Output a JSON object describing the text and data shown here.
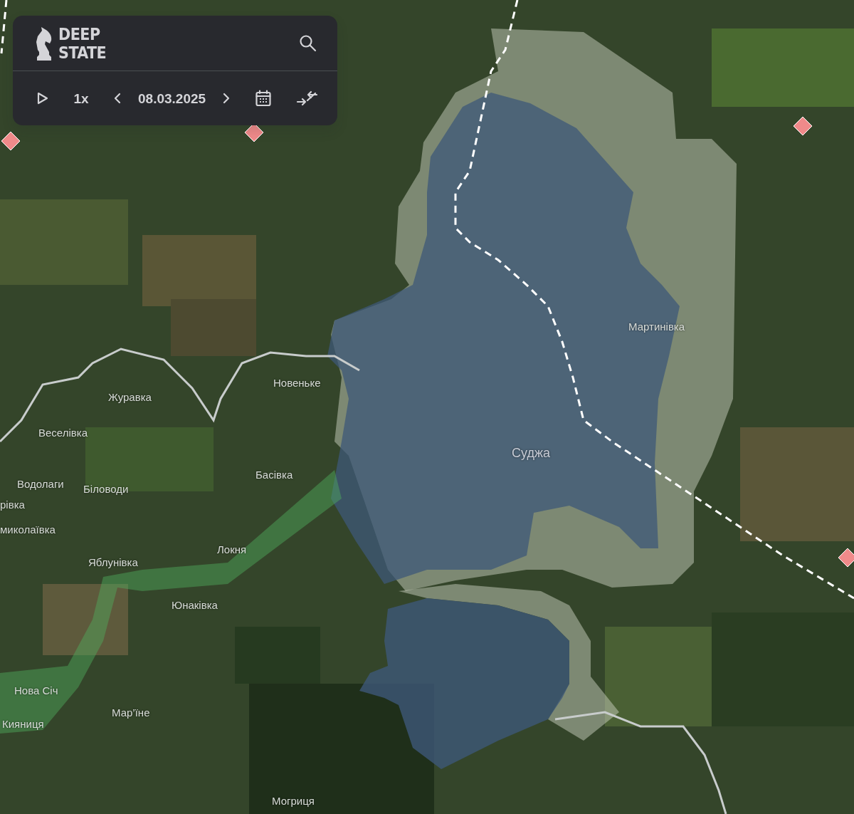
{
  "logo": {
    "lines": [
      "DEEP",
      "STATE"
    ]
  },
  "controls": {
    "speed": "1x",
    "date": "08.03.2025"
  },
  "map": {
    "places": [
      {
        "name": "Мартинівка",
        "kind": "village"
      },
      {
        "name": "Новеньке",
        "kind": "village"
      },
      {
        "name": "Журавка",
        "kind": "village"
      },
      {
        "name": "Веселівка",
        "kind": "village"
      },
      {
        "name": "Суджа",
        "kind": "town"
      },
      {
        "name": "Басівка",
        "kind": "village"
      },
      {
        "name": "Водолаги",
        "kind": "village"
      },
      {
        "name": "Біловоди",
        "kind": "village"
      },
      {
        "name": "рівка",
        "kind": "village"
      },
      {
        "name": "миколаївка",
        "kind": "village"
      },
      {
        "name": "Локня",
        "kind": "village"
      },
      {
        "name": "Яблунівка",
        "kind": "village"
      },
      {
        "name": "Юнаківка",
        "kind": "village"
      },
      {
        "name": "Нова Січ",
        "kind": "village"
      },
      {
        "name": "Мар’їне",
        "kind": "village"
      },
      {
        "name": "Кияниця",
        "kind": "village"
      },
      {
        "name": "Могриця",
        "kind": "village"
      }
    ]
  }
}
